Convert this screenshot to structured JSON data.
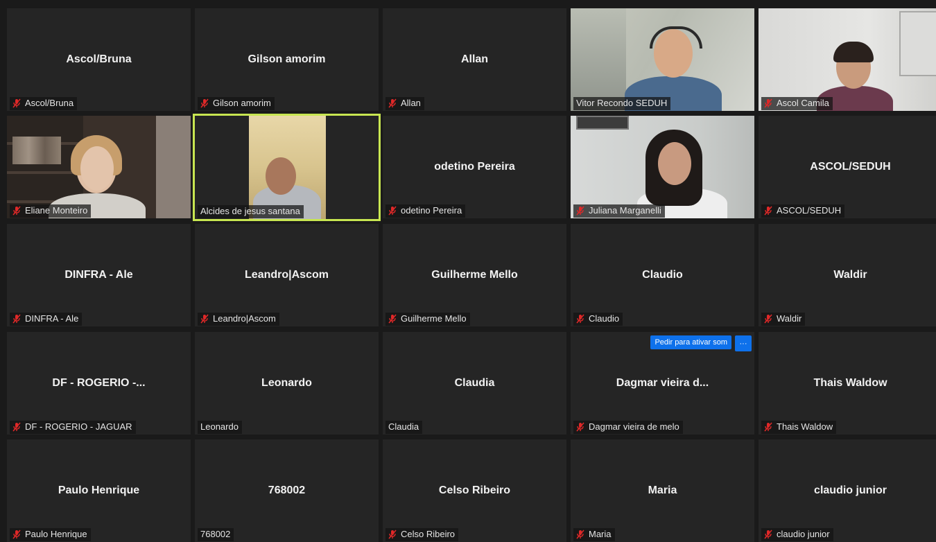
{
  "meeting": {
    "participants": [
      {
        "display_name": "Ascol/Bruna",
        "label": "Ascol/Bruna",
        "muted": true,
        "video": false
      },
      {
        "display_name": "Gilson amorim",
        "label": "Gilson amorim",
        "muted": true,
        "video": false
      },
      {
        "display_name": "Allan",
        "label": "Allan",
        "muted": true,
        "video": false
      },
      {
        "display_name": "",
        "label": "Vitor Recondo SEDUH",
        "muted": false,
        "video": true
      },
      {
        "display_name": "",
        "label": "Ascol Camila",
        "muted": true,
        "video": true
      },
      {
        "display_name": "",
        "label": "Eliane Monteiro",
        "muted": true,
        "video": true
      },
      {
        "display_name": "",
        "label": "Alcides de jesus santana",
        "muted": false,
        "video": true,
        "active_speaker": true
      },
      {
        "display_name": "odetino Pereira",
        "label": "odetino Pereira",
        "muted": true,
        "video": false
      },
      {
        "display_name": "",
        "label": "Juliana Marganelli",
        "muted": true,
        "video": true
      },
      {
        "display_name": "ASCOL/SEDUH",
        "label": "ASCOL/SEDUH",
        "muted": true,
        "video": false
      },
      {
        "display_name": "DINFRA - Ale",
        "label": "DINFRA - Ale",
        "muted": true,
        "video": false
      },
      {
        "display_name": "Leandro|Ascom",
        "label": "Leandro|Ascom",
        "muted": true,
        "video": false
      },
      {
        "display_name": "Guilherme Mello",
        "label": "Guilherme Mello",
        "muted": true,
        "video": false
      },
      {
        "display_name": "Claudio",
        "label": "Claudio",
        "muted": true,
        "video": false
      },
      {
        "display_name": "Waldir",
        "label": "Waldir",
        "muted": true,
        "video": false
      },
      {
        "display_name": "DF - ROGERIO -...",
        "label": "DF - ROGERIO - JAGUAR",
        "muted": true,
        "video": false
      },
      {
        "display_name": "Leonardo",
        "label": "Leonardo",
        "muted": false,
        "video": false
      },
      {
        "display_name": "Claudia",
        "label": "Claudia",
        "muted": false,
        "video": false
      },
      {
        "display_name": "Dagmar vieira d...",
        "label": "Dagmar vieira de melo",
        "muted": true,
        "video": false
      },
      {
        "display_name": "Thais Waldow",
        "label": "Thais Waldow",
        "muted": true,
        "video": false
      },
      {
        "display_name": "Paulo Henrique",
        "label": "Paulo Henrique",
        "muted": true,
        "video": false
      },
      {
        "display_name": "768002",
        "label": "768002",
        "muted": false,
        "video": false
      },
      {
        "display_name": "Celso Ribeiro",
        "label": "Celso Ribeiro",
        "muted": true,
        "video": false
      },
      {
        "display_name": "Maria",
        "label": "Maria",
        "muted": true,
        "video": false
      },
      {
        "display_name": "claudio junior",
        "label": "claudio junior",
        "muted": true,
        "video": false
      }
    ],
    "hover_tile_actions": {
      "ask_unmute_label": "Pedir para ativar som",
      "more_label": "···"
    },
    "colors": {
      "background": "#1a1a1a",
      "tile": "#252525",
      "active_speaker_border": "#c8e651",
      "muted_icon": "#e02828",
      "button_blue": "#0e71eb"
    }
  }
}
